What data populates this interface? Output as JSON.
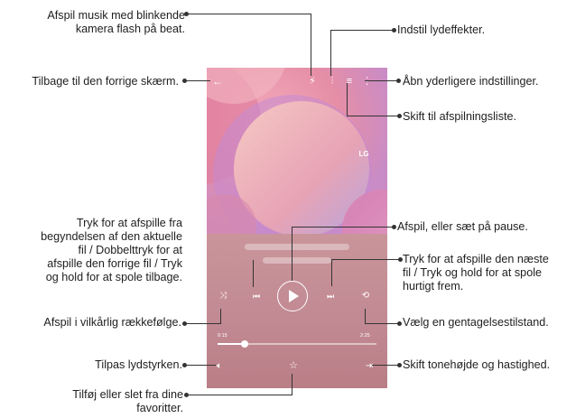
{
  "colors": {
    "art_bg": "#e89cae",
    "player_bg": "#c28a93",
    "line": "#333333"
  },
  "labels": {
    "flash": "Afspil musik med blinkende\nkamera flash på beat.",
    "effects": "Indstil lydeffekter.",
    "back": "Tilbage til den forrige skærm.",
    "more": "Åbn yderligere indstillinger.",
    "playlist": "Skift til afspilningsliste.",
    "prev": "Tryk for at afspille fra\nbegyndelsen af den aktuelle\nfil / Dobbelttryk for at\nafspille den forrige fil / Tryk\nog hold for at spole tilbage.",
    "playpause": "Afspil, eller sæt på pause.",
    "next": "Tryk for at afspille den næste\nfil / Tryk og hold for at spole\nhurtigt frem.",
    "shuffle": "Afspil i vilkårlig rækkefølge.",
    "repeat": "Vælg en gentagelsestilstand.",
    "volume": "Tilpas lydstyrken.",
    "pitch": "Skift tonehøjde og hastighed.",
    "favorite": "Tilføj eller slet fra dine\nfavoritter."
  },
  "player": {
    "brand": "LG",
    "time_elapsed": "0:15",
    "time_total": "2:25",
    "progress": 0.17
  },
  "icons": [
    "back-arrow-icon",
    "flash-icon",
    "equalizer-icon",
    "playlist-icon",
    "more-icon",
    "lg-logo-icon",
    "shuffle-icon",
    "previous-icon",
    "play-icon",
    "next-icon",
    "repeat-icon",
    "volume-icon",
    "star-icon",
    "pitch-icon"
  ]
}
